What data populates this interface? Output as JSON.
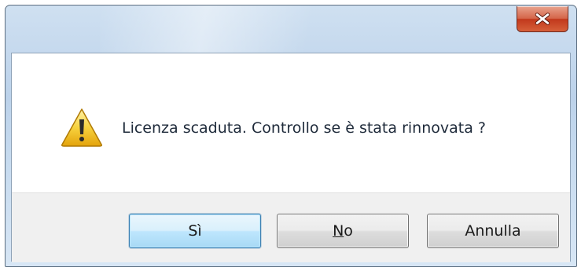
{
  "dialog": {
    "title": "",
    "message": "Licenza scaduta. Controllo se è stata rinnovata ?",
    "icon": "warning-icon"
  },
  "buttons": {
    "yes_label": "Sì",
    "no_mnemonic": "N",
    "no_rest": "o",
    "cancel_label": "Annulla"
  },
  "colors": {
    "close_button": "#c2391c",
    "default_button_border": "#3c7fb1",
    "warning_yellow": "#f4c20d"
  }
}
